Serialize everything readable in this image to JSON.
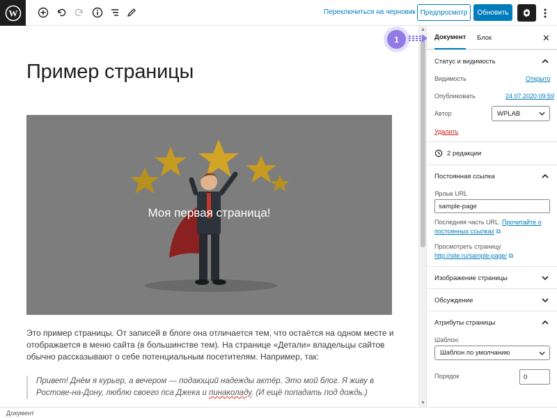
{
  "toolbar": {
    "switch_to_draft": "Переключиться на черновик",
    "preview": "Предпросмотр",
    "update": "Обновить",
    "icons": [
      "wordpress-logo",
      "add-block",
      "undo",
      "redo",
      "info",
      "list-view",
      "tools-pencil",
      "settings-gear",
      "more-vertical"
    ]
  },
  "editor": {
    "title": "Пример страницы",
    "cover_text": "Моя первая страница!",
    "paragraph": "Это пример страницы. От записей в блоге она отличается тем, что остаётся на одном месте и отображается в меню сайта (в большинстве тем). На странице «Детали» владельцы сайтов обычно рассказывают о себе потенциальным посетителям. Например, так:",
    "quote_part1": "Привет! Днём я курьер, а вечером — подающий надежды актёр. Это мой блог. Я живу в Ростове-на-Дону, люблю своего пса Джека и ",
    "quote_misspelled": "пинаколаду",
    "quote_part2": ". (И ещё попадать под дождь.)"
  },
  "sidebar": {
    "tabs": [
      "Документ",
      "Блок"
    ],
    "active_tab": "Документ",
    "status": {
      "title": "Статус и видимость",
      "visibility_label": "Видимость",
      "visibility_value": "Открыто",
      "published_label": "Опубликовать",
      "published_value": "24.07.2020 09:59",
      "author_label": "Автор",
      "author_value": "WPLAB",
      "delete": "Удалить"
    },
    "revisions": "2 редакции",
    "permalink": {
      "title": "Постоянная ссылка",
      "slug_label": "Ярлык URL",
      "slug_value": "sample-page",
      "help_prefix": "Последняя часть URL.",
      "help_link": "Прочитайте о постоянных ссылках",
      "view_label": "Просмотреть страницу",
      "view_link": "http://site.ru/sample-page/"
    },
    "featured_image": "Изображение страницы",
    "discussion": "Обсуждение",
    "attributes": {
      "title": "Атрибуты страницы",
      "template_label": "Шаблон:",
      "template_value": "Шаблон по умолчанию",
      "order_label": "Порядок",
      "order_value": "0"
    }
  },
  "annotation": {
    "step": "1"
  },
  "footer": {
    "breadcrumb": "Документ"
  },
  "colors": {
    "accent": "#007cba",
    "dark": "#1e1e1e",
    "badge": "#8f7ae6",
    "cover_bg": "#7d7d7d"
  }
}
